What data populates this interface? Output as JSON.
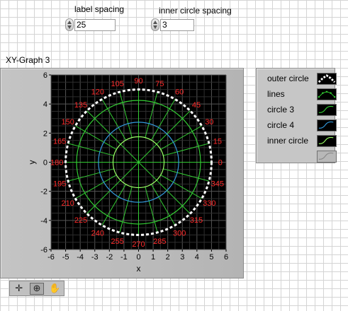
{
  "controls": {
    "label_spacing": {
      "label": "label spacing",
      "value": "25"
    },
    "inner_circle_spacing": {
      "label": "inner circle spacing",
      "value": "3"
    }
  },
  "graph": {
    "title": "XY-Graph 3",
    "xlabel": "x",
    "ylabel": "y",
    "x_ticks": [
      "-6",
      "-5",
      "-4",
      "-3",
      "-2",
      "-1",
      "0",
      "1",
      "2",
      "3",
      "4",
      "5",
      "6"
    ],
    "y_ticks": [
      "6",
      "4",
      "2",
      "0",
      "-2",
      "-4",
      "-6"
    ],
    "angle_labels": [
      "0",
      "15",
      "30",
      "45",
      "60",
      "75",
      "90",
      "105",
      "120",
      "135",
      "150",
      "165",
      "180",
      "195",
      "210",
      "225",
      "240",
      "255",
      "270",
      "285",
      "300",
      "315",
      "330",
      "345"
    ]
  },
  "legend": {
    "items": [
      {
        "name": "outer circle",
        "swatch": "dashed-white"
      },
      {
        "name": "lines",
        "swatch": "green-dots"
      },
      {
        "name": "circle 3",
        "swatch": "green-wave"
      },
      {
        "name": "circle 4",
        "swatch": "blue-wave"
      },
      {
        "name": "inner circle",
        "swatch": "lightgreen-wave"
      },
      {
        "name": "",
        "swatch": "gray-wave"
      }
    ]
  },
  "palette": {
    "tools": [
      {
        "name": "cursor-move-icon",
        "glyph": "✛"
      },
      {
        "name": "zoom-icon",
        "glyph": "⊕"
      },
      {
        "name": "pan-hand-icon",
        "glyph": "✋"
      }
    ]
  },
  "chart_data": {
    "type": "scatter",
    "xlabel": "x",
    "ylabel": "y",
    "xlim": [
      -6,
      6
    ],
    "ylim": [
      -6,
      6
    ],
    "x_ticks": [
      -6,
      -5,
      -4,
      -3,
      -2,
      -1,
      0,
      1,
      2,
      3,
      4,
      5,
      6
    ],
    "y_ticks": [
      -6,
      -4,
      -2,
      0,
      2,
      4,
      6
    ],
    "series": [
      {
        "name": "outer circle",
        "shape": "circle",
        "radius": 5,
        "color": "#ffffff",
        "style": "dashed"
      },
      {
        "name": "lines",
        "shape": "radial lines",
        "angles_deg_step": 15,
        "from_radius": 1.75,
        "to_radius": 5,
        "color": "#33cc33"
      },
      {
        "name": "circle 3",
        "shape": "circle",
        "radius": 4.25,
        "color": "#33cc33"
      },
      {
        "name": "circle 4",
        "shape": "circle",
        "radius": 2.75,
        "color": "#3399dd"
      },
      {
        "name": "inner circle",
        "shape": "circle",
        "radius": 1.75,
        "color": "#99ff66"
      }
    ],
    "angle_labels": {
      "radius": 5.6,
      "step_deg": 15,
      "color": "#ff2a2a"
    },
    "grid": true,
    "legend": "right"
  }
}
